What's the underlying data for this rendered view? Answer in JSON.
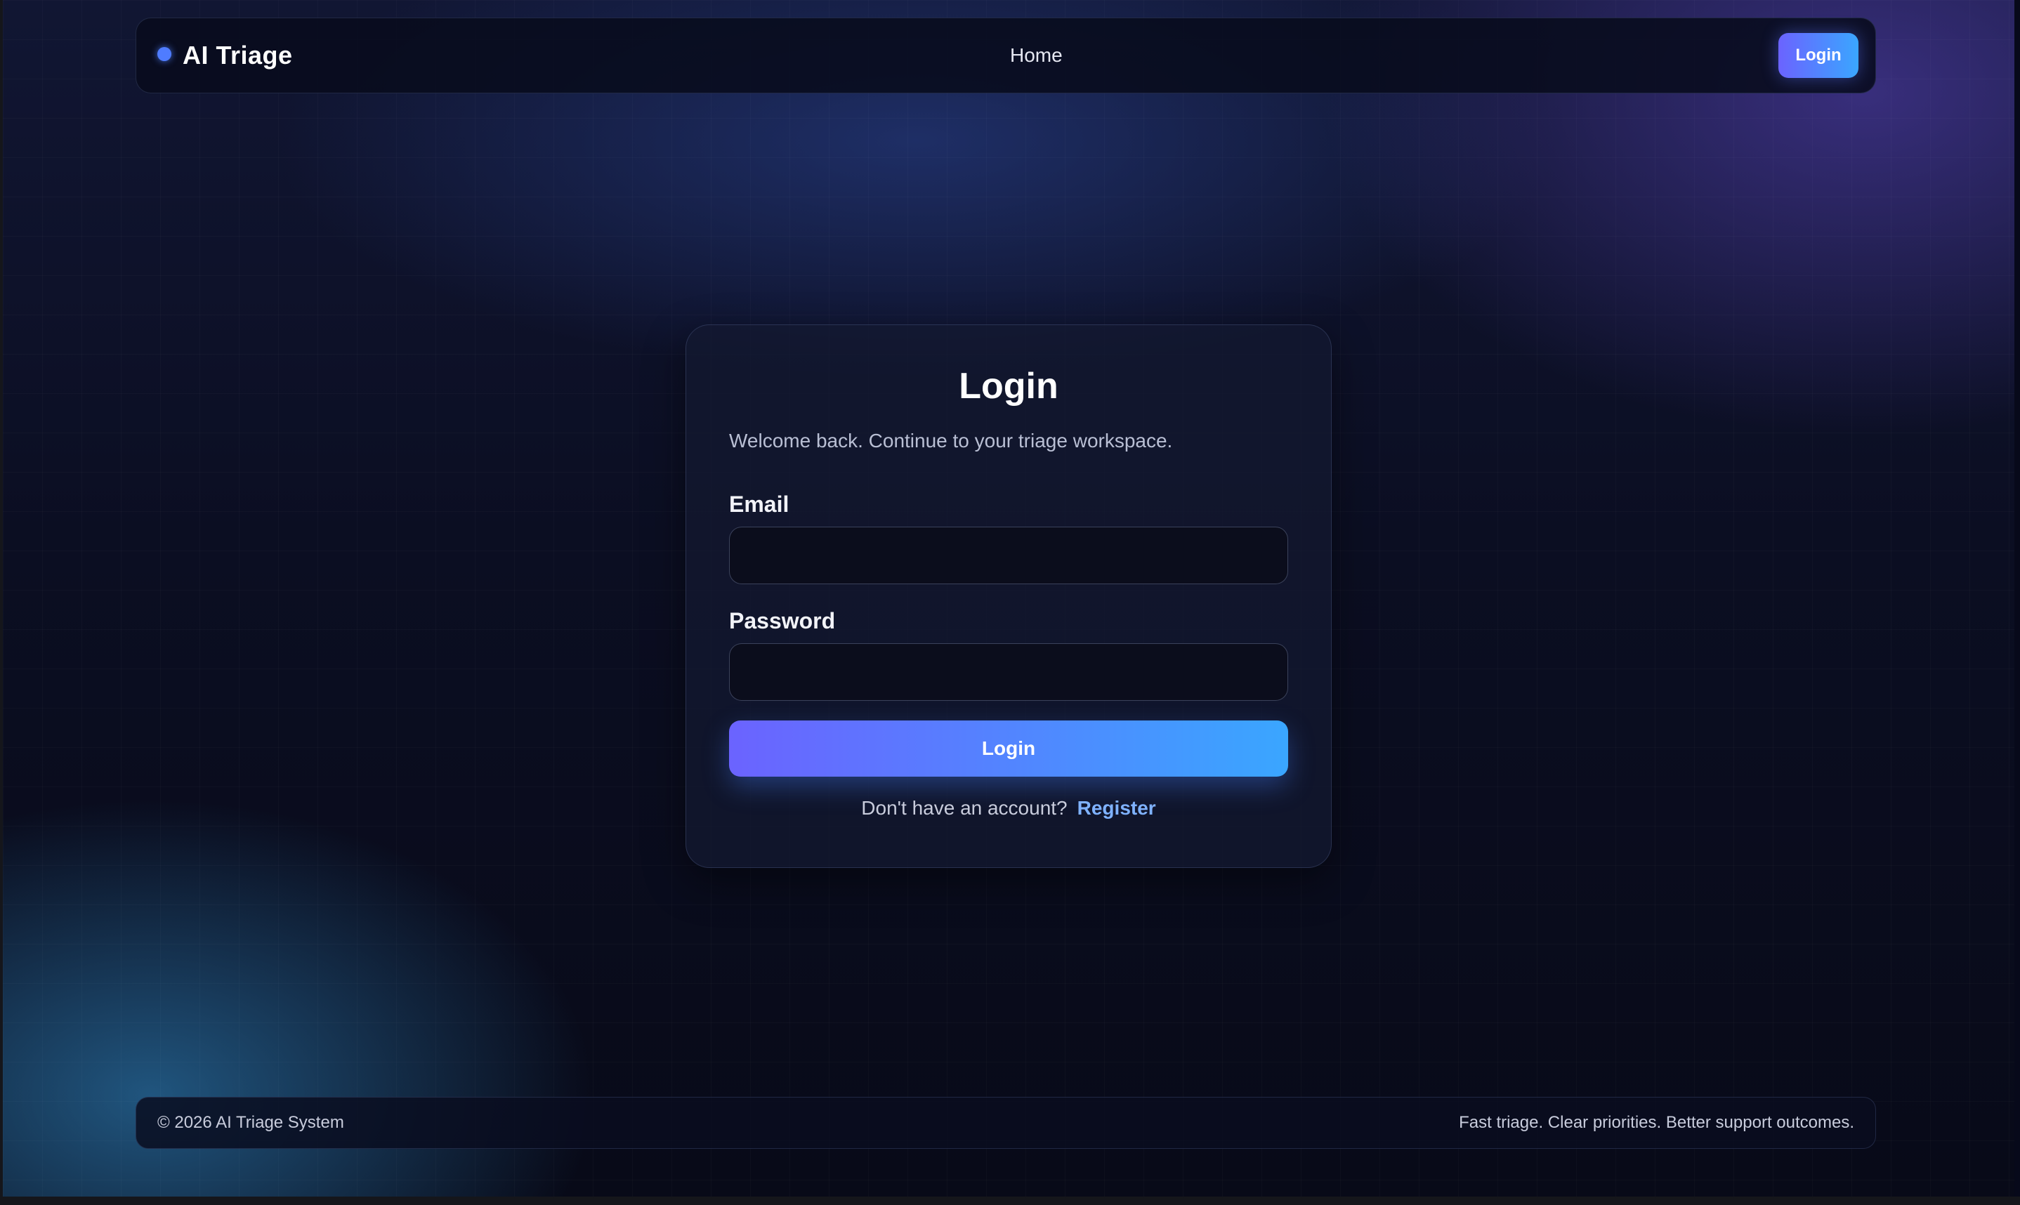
{
  "navbar": {
    "brand": "AI Triage",
    "links": [
      {
        "label": "Home"
      }
    ],
    "login_button": "Login"
  },
  "login_card": {
    "title": "Login",
    "subtitle": "Welcome back. Continue to your triage workspace.",
    "email_label": "Email",
    "email_value": "",
    "password_label": "Password",
    "password_value": "",
    "submit_label": "Login",
    "register_prompt": "Don't have an account?",
    "register_link": "Register"
  },
  "footer": {
    "copyright": "© 2026 AI Triage System",
    "tagline": "Fast triage. Clear priorities. Better support outcomes."
  },
  "colors": {
    "accent_start": "#6b63ff",
    "accent_end": "#3aa6ff",
    "link": "#7fb2ff",
    "background": "#080a18"
  },
  "icons": {
    "brand": "dot-icon"
  }
}
